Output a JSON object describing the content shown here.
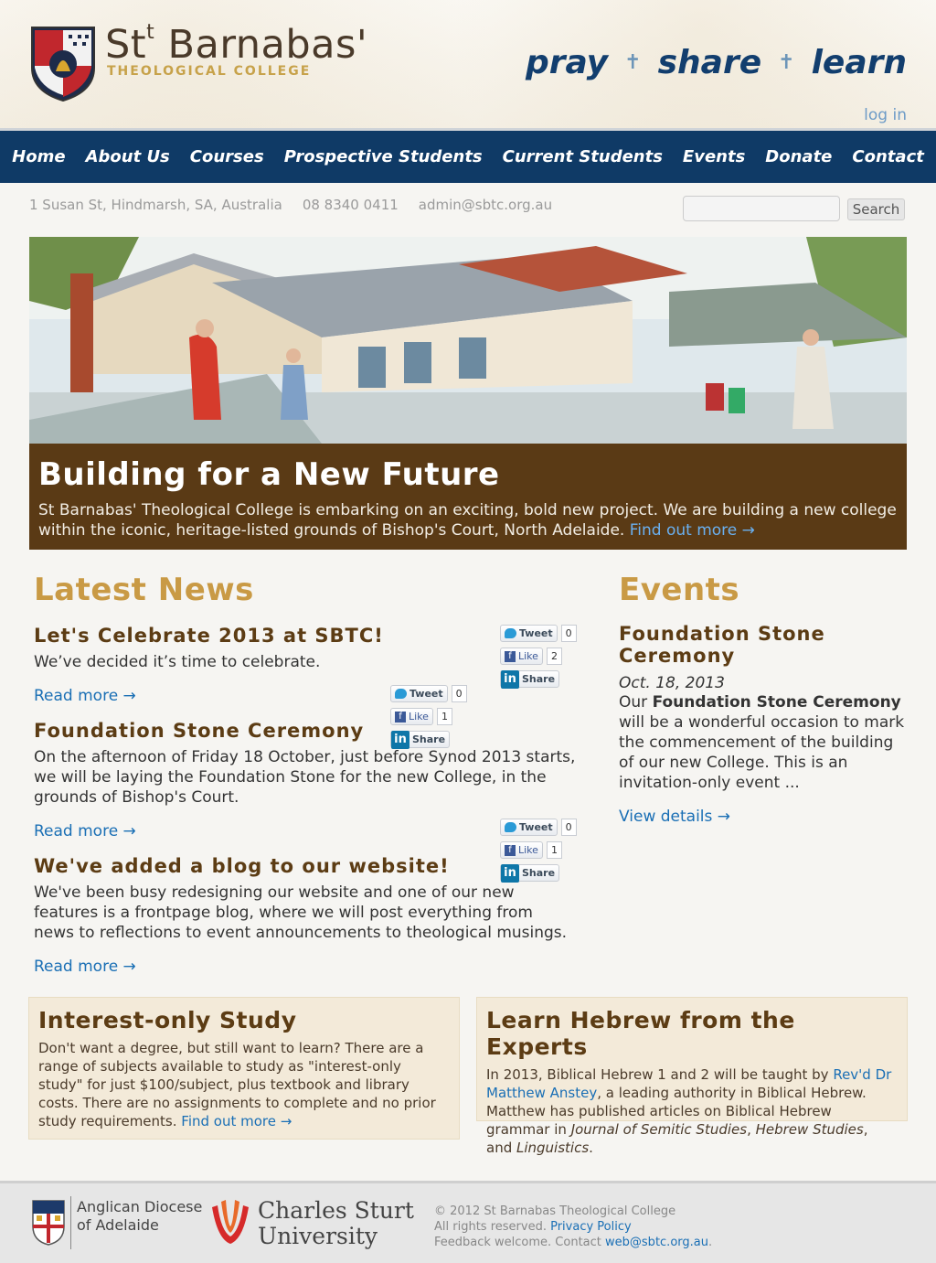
{
  "header": {
    "brand_name": "Barnabas'",
    "brand_prefix": "St",
    "brand_sub": "THEOLOGICAL COLLEGE",
    "tagline": [
      "pray",
      "share",
      "learn"
    ],
    "login": "log in"
  },
  "nav": [
    "Home",
    "About Us",
    "Courses",
    "Prospective Students",
    "Current Students",
    "Events",
    "Donate",
    "Contact"
  ],
  "contact": {
    "address": "1 Susan St, Hindmarsh, SA, Australia",
    "phone": "08 8340 0411",
    "email": "admin@sbtc.org.au"
  },
  "search": {
    "placeholder": "",
    "button": "Search"
  },
  "hero": {
    "title": "Building for a New Future",
    "text": "St Barnabas' Theological College is embarking on an exciting, bold new project. We are building a new college within the iconic, heritage-listed grounds of Bishop's Court, North Adelaide.",
    "link": "Find out more →"
  },
  "news": {
    "title": "Latest News",
    "posts": [
      {
        "title": "Let's Celebrate 2013 at SBTC!",
        "body": "We’ve decided it’s time to celebrate.",
        "read_more": "Read more →",
        "tweet": "Tweet",
        "tweet_count": "0",
        "like": "Like",
        "like_count": "2",
        "share": "Share"
      },
      {
        "title": "Foundation Stone Ceremony",
        "body": "On the afternoon of Friday 18 October, just before Synod 2013 starts, we will be laying the Foundation Stone for the new College, in the grounds of Bishop's Court.",
        "read_more": "Read more →",
        "tweet": "Tweet",
        "tweet_count": "0",
        "like": "Like",
        "like_count": "1",
        "share": "Share"
      },
      {
        "title": "We've added a blog to our website!",
        "body": "We've been busy redesigning our website and one of our new features is a frontpage blog, where we will post everything from news to reflections to event announcements to theological musings.",
        "read_more": "Read more →",
        "tweet": "Tweet",
        "tweet_count": "0",
        "like": "Like",
        "like_count": "1",
        "share": "Share"
      }
    ]
  },
  "events": {
    "title": "Events",
    "items": [
      {
        "title": "Foundation Stone Ceremony",
        "date": "Oct. 18, 2013",
        "bold": "Foundation Stone Ceremony",
        "prefix": "Our",
        "body": " will be a wonderful occasion to mark the commencement of the building of our new College. This is an invitation-only event ...",
        "link": "View details →"
      }
    ]
  },
  "promos": [
    {
      "title": "Interest-only Study",
      "text": "Don't want a degree, but still want to learn? There are a range of subjects available to study as \"interest-only study\" for just $100/subject, plus textbook and library costs. There are no assignments to complete and no prior study requirements.",
      "link": "Find out more →"
    },
    {
      "title": "Learn Hebrew from the Experts",
      "text_a": "In 2013, Biblical Hebrew 1 and 2 will be taught by ",
      "link": "Rev'd Dr Matthew Anstey",
      "text_b": ", a leading authority in Biblical Hebrew. Matthew has published articles on Biblical Hebrew grammar in ",
      "journal_1": "Journal of Semitic Studies",
      "sep": ", ",
      "journal_2": "Hebrew Studies",
      "and": ", and ",
      "journal_3": "Linguistics",
      "end": "."
    }
  ],
  "footer": {
    "diocese": [
      "Anglican Diocese",
      "of Adelaide"
    ],
    "csu": [
      "Charles Sturt",
      "University"
    ],
    "copyright": "© 2012 St Barnabas Theological College",
    "rights": "All rights reserved.",
    "privacy": "Privacy Policy",
    "feedback": "Feedback welcome. Contact",
    "feedback_email": "web@sbtc.org.au",
    "period": "."
  },
  "colors": {
    "nav": "#0f3a66",
    "gold": "#c99a45",
    "brown": "#5c3c14",
    "hero_caption": "#5a3a15",
    "link": "#1a6fb5"
  }
}
